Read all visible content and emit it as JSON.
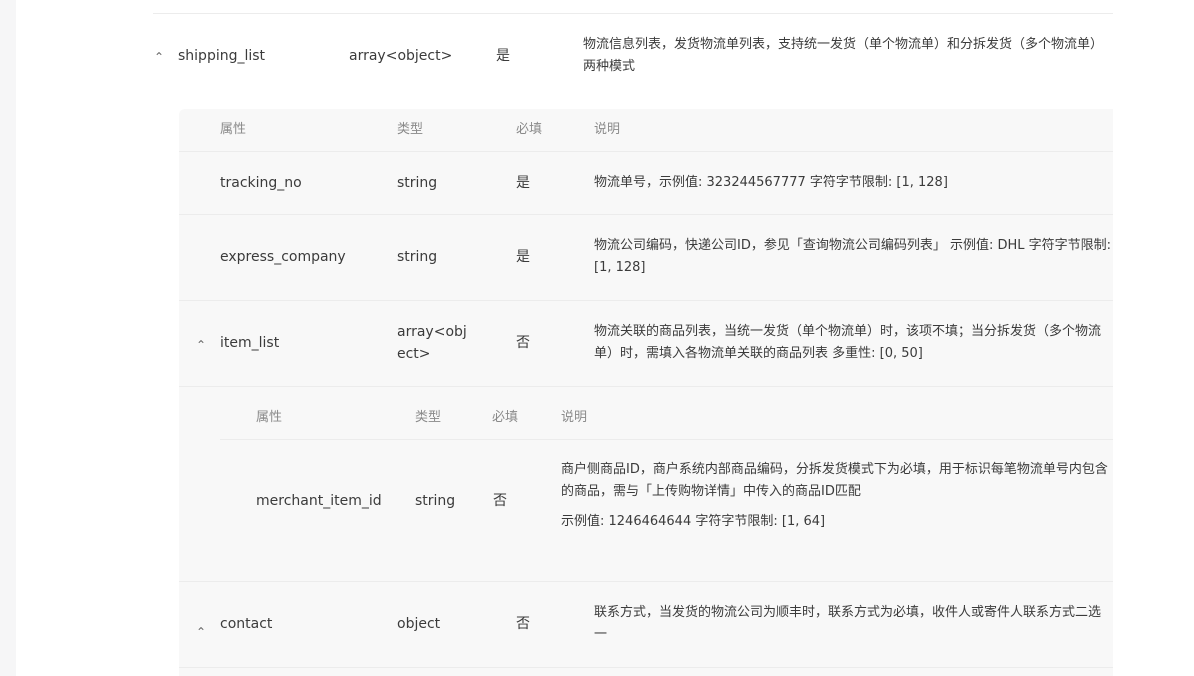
{
  "outer": {
    "name": "shipping_list",
    "type": "array<object>",
    "required": "是",
    "description": "物流信息列表，发货物流单列表，支持统一发货（单个物流单）和分拆发货（多个物流单）两种模式"
  },
  "table1": {
    "headers": {
      "attr": "属性",
      "type": "类型",
      "required": "必填",
      "desc": "说明"
    },
    "rows": [
      {
        "name": "tracking_no",
        "type": "string",
        "required": "是",
        "description": "物流单号，示例值: 323244567777 字符字节限制: [1, 128]"
      },
      {
        "name": "express_company",
        "type": "string",
        "required": "是",
        "description": "物流公司编码，快递公司ID，参见「查询物流公司编码列表」 示例值: DHL 字符字节限制: [1, 128]"
      },
      {
        "name": "item_list",
        "type": "array<object>",
        "required": "否",
        "description": "物流关联的商品列表，当统一发货（单个物流单）时，该项不填；当分拆发货（多个物流单）时，需填入各物流单关联的商品列表 多重性: [0, 50]"
      },
      {
        "name": "contact",
        "type": "object",
        "required": "否",
        "description": "联系方式，当发货的物流公司为顺丰时，联系方式为必填，收件人或寄件人联系方式二选一"
      }
    ]
  },
  "table2": {
    "headers": {
      "attr": "属性",
      "type": "类型",
      "required": "必填",
      "desc": "说明"
    },
    "rows": [
      {
        "name": "merchant_item_id",
        "type": "string",
        "required": "否",
        "description": "商户侧商品ID，商户系统内部商品编码，分拆发货模式下为必填，用于标识每笔物流单号内包含的商品，需与「上传购物详情」中传入的商品ID匹配",
        "example": "示例值: 1246464644 字符字节限制: [1, 64]"
      }
    ]
  },
  "icons": {
    "expand": "chevron-up-icon"
  }
}
